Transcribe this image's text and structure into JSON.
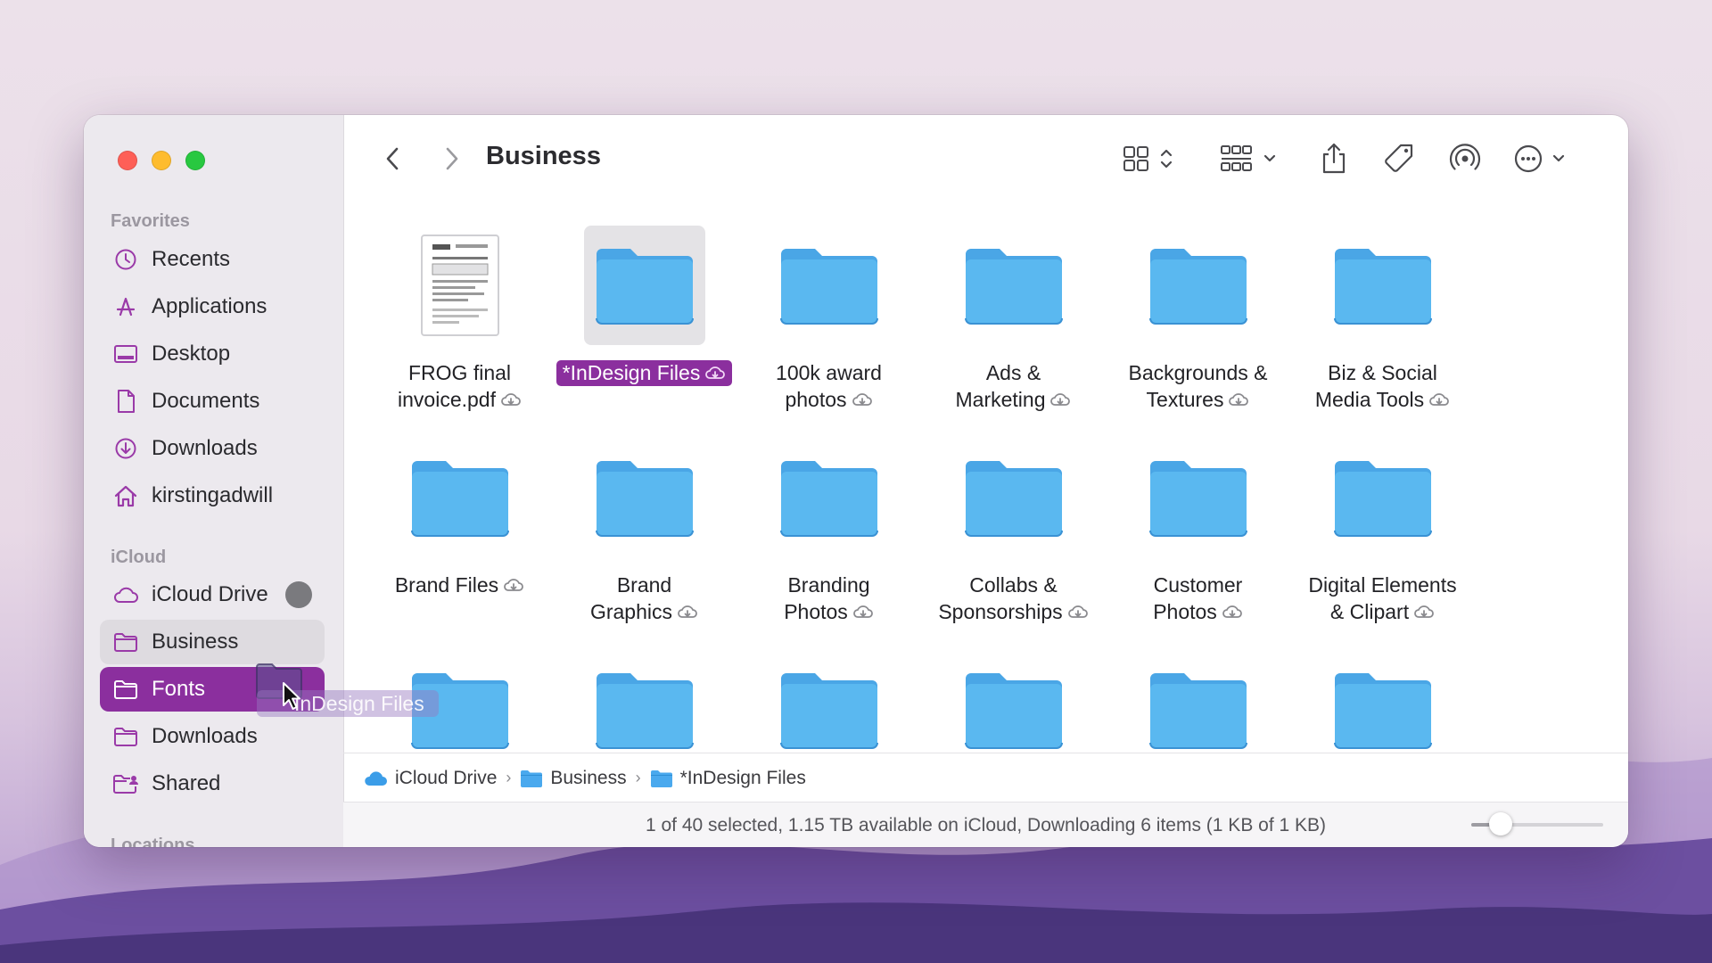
{
  "window": {
    "title": "Business",
    "sidebar": {
      "favorites_title": "Favorites",
      "favorites": [
        {
          "label": "Recents",
          "icon": "clock-icon"
        },
        {
          "label": "Applications",
          "icon": "applications-icon"
        },
        {
          "label": "Desktop",
          "icon": "desktop-icon"
        },
        {
          "label": "Documents",
          "icon": "document-icon"
        },
        {
          "label": "Downloads",
          "icon": "download-icon"
        },
        {
          "label": "kirstingadwill",
          "icon": "home-icon"
        }
      ],
      "icloud_title": "iCloud",
      "icloud": [
        {
          "label": "iCloud Drive",
          "icon": "cloud-icon"
        },
        {
          "label": "Business",
          "icon": "folder-icon"
        },
        {
          "label": "Fonts",
          "icon": "folder-icon"
        },
        {
          "label": "Downloads",
          "icon": "folder-icon"
        },
        {
          "label": "Shared",
          "icon": "shared-folder-icon"
        }
      ],
      "locations_title": "Locations"
    },
    "files": [
      {
        "line1": "FROG final",
        "line2": "invoice.pdf",
        "type": "pdf"
      },
      {
        "line1": "*InDesign Files",
        "line2": "",
        "type": "folder",
        "selected": true
      },
      {
        "line1": "100k award",
        "line2": "photos",
        "type": "folder"
      },
      {
        "line1": "Ads &",
        "line2": "Marketing",
        "type": "folder"
      },
      {
        "line1": "Backgrounds &",
        "line2": "Textures",
        "type": "folder"
      },
      {
        "line1": "Biz & Social",
        "line2": "Media Tools",
        "type": "folder"
      },
      {
        "line1": "",
        "line2": "Brand Files",
        "type": "folder"
      },
      {
        "line1": "Brand",
        "line2": "Graphics",
        "type": "folder"
      },
      {
        "line1": "Branding",
        "line2": "Photos",
        "type": "folder"
      },
      {
        "line1": "Collabs &",
        "line2": "Sponsorships",
        "type": "folder"
      },
      {
        "line1": "Customer",
        "line2": "Photos",
        "type": "folder"
      },
      {
        "line1": "Digital Elements",
        "line2": "& Clipart",
        "type": "folder"
      },
      {
        "line1": "",
        "line2": "",
        "type": "folder"
      },
      {
        "line1": "",
        "line2": "",
        "type": "folder"
      },
      {
        "line1": "",
        "line2": "",
        "type": "folder"
      },
      {
        "line1": "",
        "line2": "",
        "type": "folder"
      },
      {
        "line1": "",
        "line2": "",
        "type": "folder"
      },
      {
        "line1": "",
        "line2": "",
        "type": "folder"
      }
    ],
    "pathbar": [
      "iCloud Drive",
      "Business",
      "*InDesign Files"
    ],
    "status": "1 of 40 selected, 1.15 TB available on iCloud, Downloading 6 items (1 KB of 1 KB)",
    "icon_size_slider": 0.22,
    "drag_label": "InDesign Files",
    "accent_color": "#8b2f9e",
    "folder_color": "#5ab8f0"
  }
}
